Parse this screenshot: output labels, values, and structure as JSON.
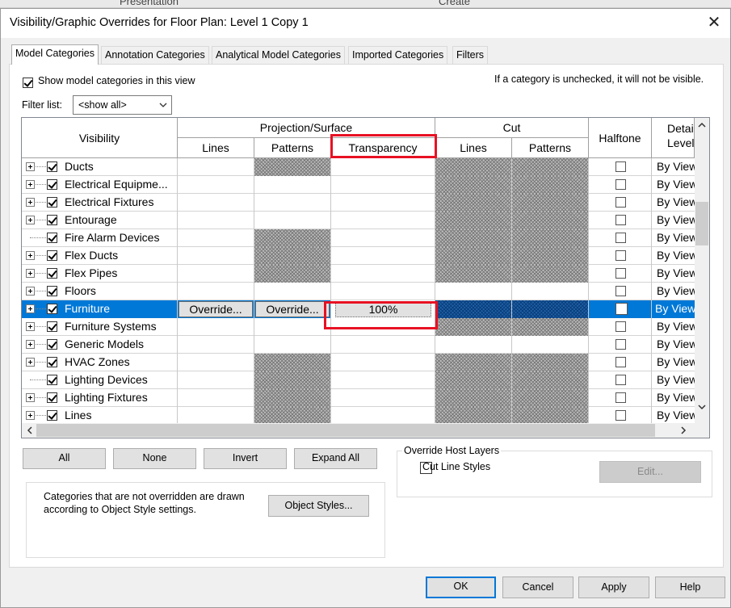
{
  "background_bar": {
    "left_label": "Presentation",
    "right_label": "Create"
  },
  "dialog": {
    "title": "Visibility/Graphic Overrides for Floor Plan: Level 1 Copy 1",
    "close_glyph": "✕"
  },
  "tabs": [
    {
      "label": "Model Categories",
      "active": true
    },
    {
      "label": "Annotation Categories",
      "active": false
    },
    {
      "label": "Analytical Model Categories",
      "active": false
    },
    {
      "label": "Imported Categories",
      "active": false
    },
    {
      "label": "Filters",
      "active": false
    }
  ],
  "show_model": {
    "label": "Show model categories in this view",
    "checked": true
  },
  "hint": "If a category is unchecked, it will not be visible.",
  "filter": {
    "label": "Filter list:",
    "value": "<show all>"
  },
  "grid": {
    "headers": {
      "visibility": "Visibility",
      "projection": "Projection/Surface",
      "lines": "Lines",
      "patterns": "Patterns",
      "transparency": "Transparency",
      "cut": "Cut",
      "cut_lines": "Lines",
      "cut_patterns": "Patterns",
      "halftone": "Halftone",
      "detail": "Detail Level"
    },
    "rows": [
      {
        "name": "Ducts",
        "expand": true,
        "proj_pat_hatch": true,
        "cut_hatch": true,
        "detail": "By View"
      },
      {
        "name": "Electrical Equipme...",
        "expand": true,
        "proj_pat_hatch": false,
        "cut_hatch": true,
        "detail": "By View"
      },
      {
        "name": "Electrical Fixtures",
        "expand": true,
        "proj_pat_hatch": false,
        "cut_hatch": true,
        "detail": "By View"
      },
      {
        "name": "Entourage",
        "expand": true,
        "proj_pat_hatch": false,
        "cut_hatch": true,
        "detail": "By View"
      },
      {
        "name": "Fire Alarm Devices",
        "expand": false,
        "proj_pat_hatch": true,
        "cut_hatch": true,
        "detail": "By View"
      },
      {
        "name": "Flex Ducts",
        "expand": true,
        "proj_pat_hatch": true,
        "cut_hatch": true,
        "detail": "By View"
      },
      {
        "name": "Flex Pipes",
        "expand": true,
        "proj_pat_hatch": true,
        "cut_hatch": true,
        "detail": "By View"
      },
      {
        "name": "Floors",
        "expand": true,
        "proj_pat_hatch": false,
        "cut_hatch": false,
        "detail": "By View"
      },
      {
        "name": "Furniture",
        "expand": true,
        "selected": true,
        "lines_btn": "Override...",
        "patterns_btn": "Override...",
        "transparency": "100%",
        "detail": "By View"
      },
      {
        "name": "Furniture Systems",
        "expand": true,
        "proj_pat_hatch": false,
        "cut_hatch": true,
        "detail": "By View"
      },
      {
        "name": "Generic Models",
        "expand": true,
        "proj_pat_hatch": false,
        "cut_hatch": false,
        "detail": "By View"
      },
      {
        "name": "HVAC Zones",
        "expand": true,
        "proj_pat_hatch": true,
        "cut_hatch": true,
        "detail": "By View"
      },
      {
        "name": "Lighting Devices",
        "expand": false,
        "proj_pat_hatch": true,
        "cut_hatch": true,
        "detail": "By View"
      },
      {
        "name": "Lighting Fixtures",
        "expand": true,
        "proj_pat_hatch": true,
        "cut_hatch": true,
        "detail": "By View"
      },
      {
        "name": "Lines",
        "expand": true,
        "proj_pat_hatch": true,
        "cut_hatch": true,
        "detail": "By View"
      }
    ]
  },
  "buttons": {
    "all": "All",
    "none": "None",
    "invert": "Invert",
    "expand_all": "Expand All"
  },
  "override_host": {
    "legend": "Override Host Layers",
    "cut_line_styles": "Cut Line Styles",
    "edit": "Edit..."
  },
  "info": {
    "text": "Categories that are not overridden are drawn according to Object Style settings.",
    "object_styles": "Object Styles..."
  },
  "footer": {
    "ok": "OK",
    "cancel": "Cancel",
    "apply": "Apply",
    "help": "Help"
  },
  "colors": {
    "selection": "#0078d7",
    "highlight": "#e81123",
    "primary_border": "#0078d7"
  }
}
